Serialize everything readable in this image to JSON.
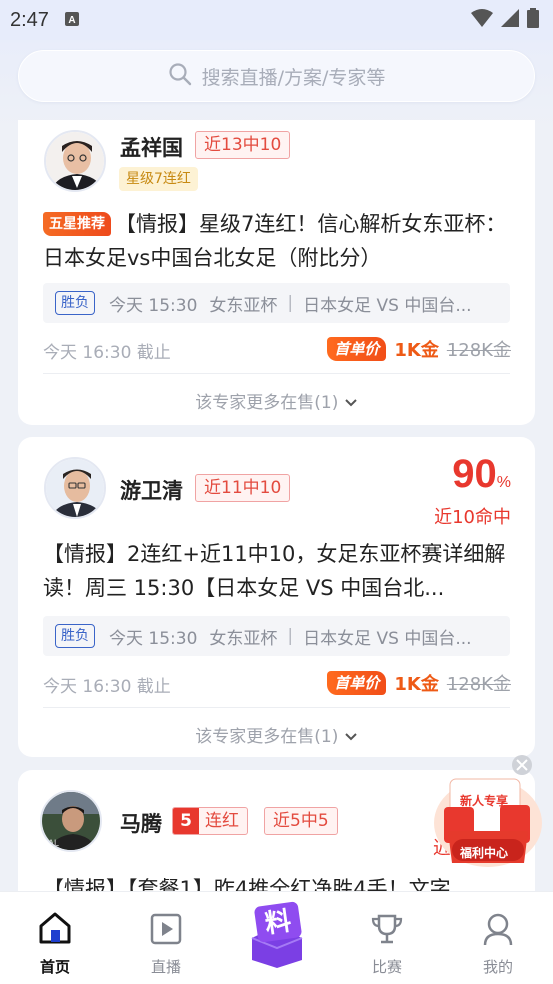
{
  "status_bar": {
    "time": "2:47"
  },
  "search": {
    "placeholder": "搜索直播/方案/专家等"
  },
  "cards": [
    {
      "expert_name": "孟祥国",
      "record_tag": "近13中10",
      "level_tag": "星级7连红",
      "badge": "五星推荐",
      "title": "【情报】星级7连红！信心解析女东亚杯：日本女足vs中国台北女足（附比分）",
      "bet_type": "胜负",
      "match_time": "今天 15:30",
      "league": "女东亚杯",
      "match": "日本女足 VS 中国台...",
      "deadline": "今天 16:30 截止",
      "first_price_label": "首单价",
      "price_now": "1K金",
      "price_old": "128K金",
      "more_text": "该专家更多在售(1)"
    },
    {
      "expert_name": "游卫清",
      "record_tag": "近11中10",
      "hit_rate": "90",
      "hit_rate_unit": "%",
      "hit_rate_caption": "近10命中",
      "title": "【情报】2连红+近11中10，女足东亚杯赛详细解读！周三 15:30【日本女足 VS 中国台北...",
      "bet_type": "胜负",
      "match_time": "今天 15:30",
      "league": "女东亚杯",
      "match": "日本女足 VS 中国台...",
      "deadline": "今天 16:30 截止",
      "first_price_label": "首单价",
      "price_now": "1K金",
      "price_old": "128K金",
      "more_text": "该专家更多在售(1)"
    },
    {
      "expert_name": "马腾",
      "streak_num": "5",
      "streak_label": "连红",
      "record_tag": "近5中5",
      "hit_rate_caption_partial": "近",
      "title_partial": "【情报】【套餐1】昨4推全红净胜4手！文字"
    }
  ],
  "welfare_widget": {
    "line1": "新人专享",
    "line2": "福利中心"
  },
  "bottom_nav": {
    "items": [
      {
        "label": "首页",
        "icon": "home-icon",
        "active": true
      },
      {
        "label": "直播",
        "icon": "play-icon",
        "active": false
      },
      {
        "label": "",
        "icon": "baoliao-icon",
        "active": false
      },
      {
        "label": "比赛",
        "icon": "trophy-icon",
        "active": false
      },
      {
        "label": "我的",
        "icon": "user-icon",
        "active": false
      }
    ]
  },
  "colors": {
    "accent_red": "#e8382e",
    "accent_orange": "#ee5a16",
    "nav_active": "#1f3fcf",
    "background": "#eef1f7"
  }
}
